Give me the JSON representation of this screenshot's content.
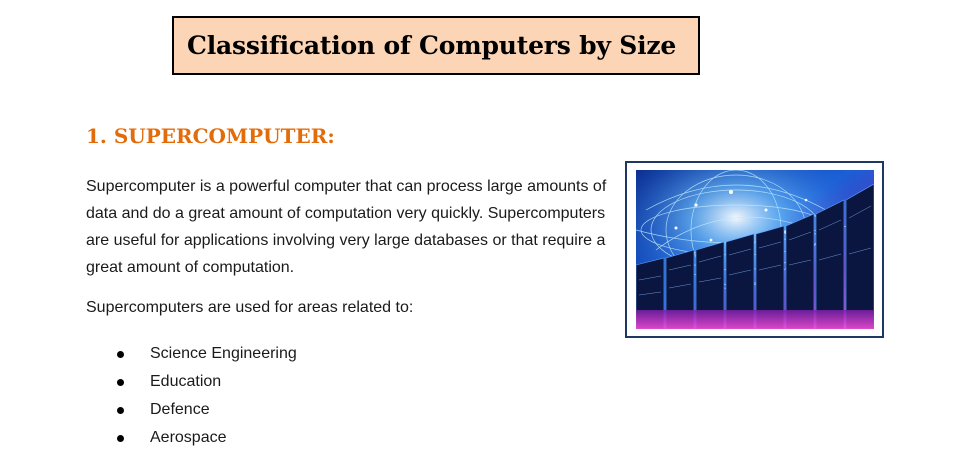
{
  "title": "Classification of Computers by Size",
  "section": {
    "heading": "1. SUPERCOMPUTER:",
    "paragraph": "Supercomputer is a powerful computer that can process large amounts of data and do a great amount of computation very quickly. Supercomputers are useful for applications involving very large databases or that require a great amount of computation.",
    "uses_intro": "Supercomputers are used for areas related to:",
    "uses": [
      "Science Engineering",
      "Education",
      "Defence",
      "Aerospace"
    ]
  },
  "image": {
    "icon": "supercomputer-server-racks-image"
  },
  "colors": {
    "title_background": "#fbd5b5",
    "heading": "#e36c0a",
    "image_border": "#1f3763"
  }
}
